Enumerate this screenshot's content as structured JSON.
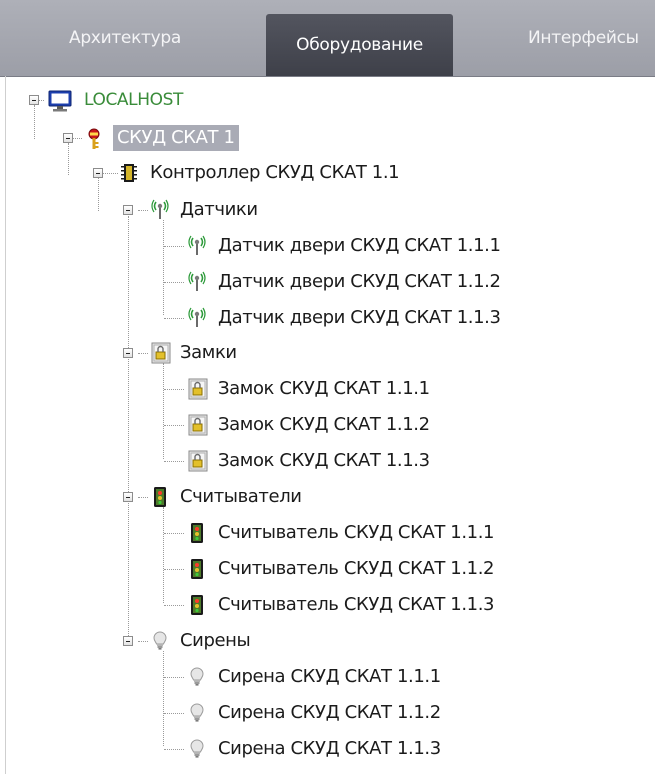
{
  "tabs": [
    {
      "label": "Архитектура"
    },
    {
      "label": "Оборудование"
    },
    {
      "label": "Интерфейсы"
    }
  ],
  "active_tab": "Оборудование",
  "tree": {
    "root": "LOCALHOST",
    "system": "СКУД СКАТ 1",
    "controller": "Контроллер СКУД СКАТ 1.1",
    "groups": [
      {
        "label": "Датчики",
        "icon": "sensor-icon",
        "items": [
          "Датчик двери СКУД СКАТ 1.1.1",
          "Датчик двери СКУД СКАТ 1.1.2",
          "Датчик двери СКУД СКАТ 1.1.3"
        ]
      },
      {
        "label": "Замки",
        "icon": "lock-icon",
        "items": [
          "Замок СКУД СКАТ 1.1.1",
          "Замок СКУД СКАТ 1.1.2",
          "Замок СКУД СКАТ 1.1.3"
        ]
      },
      {
        "label": "Считыватели",
        "icon": "reader-icon",
        "items": [
          "Считыватель СКУД СКАТ 1.1.1",
          "Считыватель СКУД СКАТ 1.1.2",
          "Считыватель СКУД СКАТ 1.1.3"
        ]
      },
      {
        "label": "Сирены",
        "icon": "siren-icon",
        "items": [
          "Сирена СКУД СКАТ 1.1.1",
          "Сирена СКУД СКАТ 1.1.2",
          "Сирена СКУД СКАТ 1.1.3"
        ]
      }
    ]
  },
  "colors": {
    "tabbar": "#a5a7b0",
    "active_tab": "#474952",
    "selection": "#a9abb5",
    "root_text": "#3a8c3a"
  }
}
